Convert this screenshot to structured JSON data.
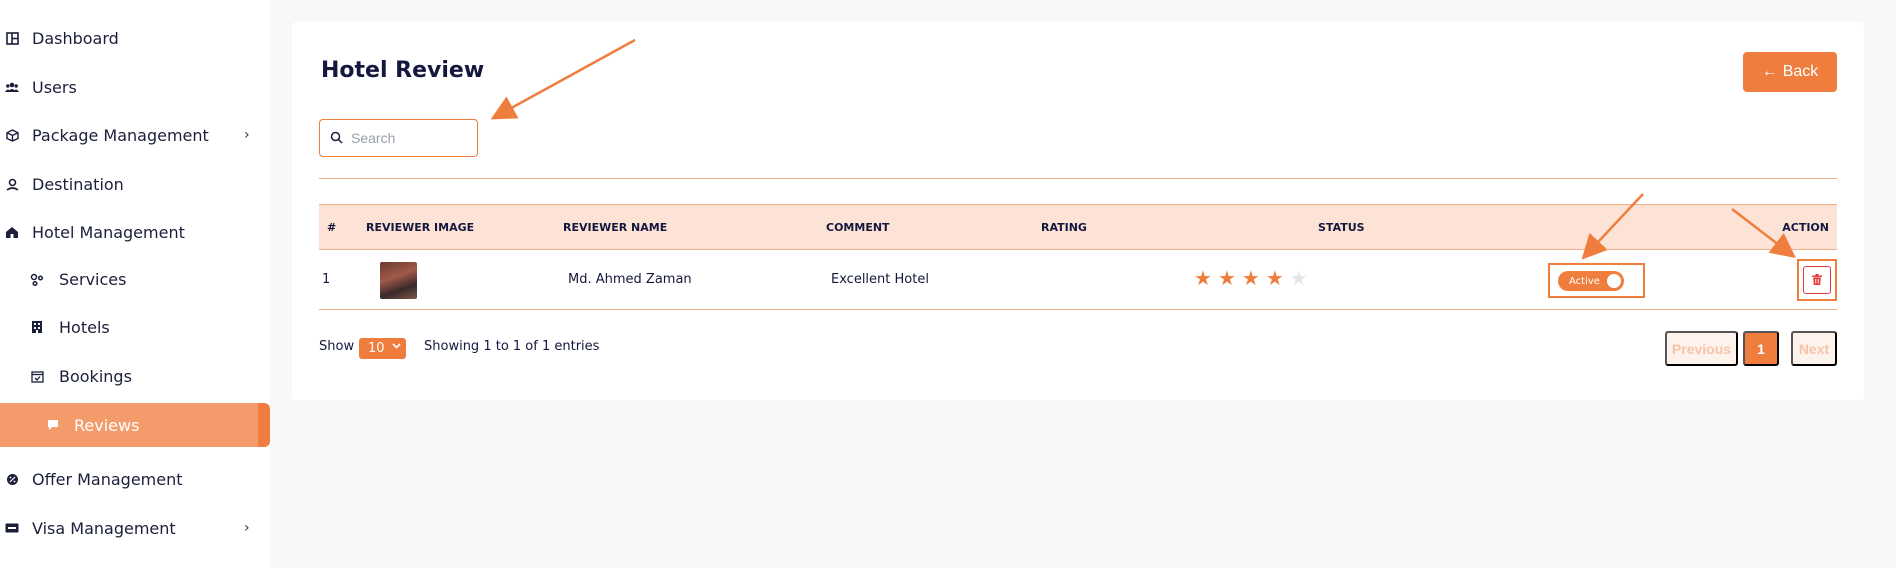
{
  "sidebar": {
    "items": [
      {
        "label": "Dashboard",
        "icon": "dashboard-icon"
      },
      {
        "label": "Users",
        "icon": "users-icon"
      },
      {
        "label": "Package Management",
        "icon": "package-icon",
        "has_children": true
      },
      {
        "label": "Destination",
        "icon": "map-pin-icon"
      },
      {
        "label": "Hotel Management",
        "icon": "hotel-icon"
      },
      {
        "label": "Services",
        "icon": "services-icon",
        "sub": true
      },
      {
        "label": "Hotels",
        "icon": "building-icon",
        "sub": true
      },
      {
        "label": "Bookings",
        "icon": "calendar-check-icon",
        "sub": true
      },
      {
        "label": "Reviews",
        "icon": "comment-icon",
        "sub": true,
        "active": true
      },
      {
        "label": "Offer Management",
        "icon": "offer-icon"
      },
      {
        "label": "Visa Management",
        "icon": "visa-icon",
        "has_children": true
      }
    ]
  },
  "page": {
    "title": "Hotel Review",
    "back_label": "Back",
    "search_placeholder": "Search"
  },
  "table": {
    "columns": [
      "#",
      "REVIEWER IMAGE",
      "REVIEWER NAME",
      "COMMENT",
      "RATING",
      "STATUS",
      "ACTION"
    ],
    "rows": [
      {
        "index": "1",
        "reviewer_name": "Md. Ahmed Zaman",
        "comment": "Excellent Hotel",
        "rating": 4,
        "rating_max": 5,
        "status": "Active"
      }
    ]
  },
  "footer": {
    "show_label": "Show",
    "page_size": "10",
    "entries_text": "Showing 1 to 1 of 1 entries",
    "prev_label": "Previous",
    "current_page": "1",
    "next_label": "Next"
  },
  "colors": {
    "accent": "#ef7e3e",
    "header_bg": "#fde3d6",
    "star_filled": "#ef7e3e",
    "star_empty": "#e6e6e6",
    "delete": "#e53935"
  }
}
